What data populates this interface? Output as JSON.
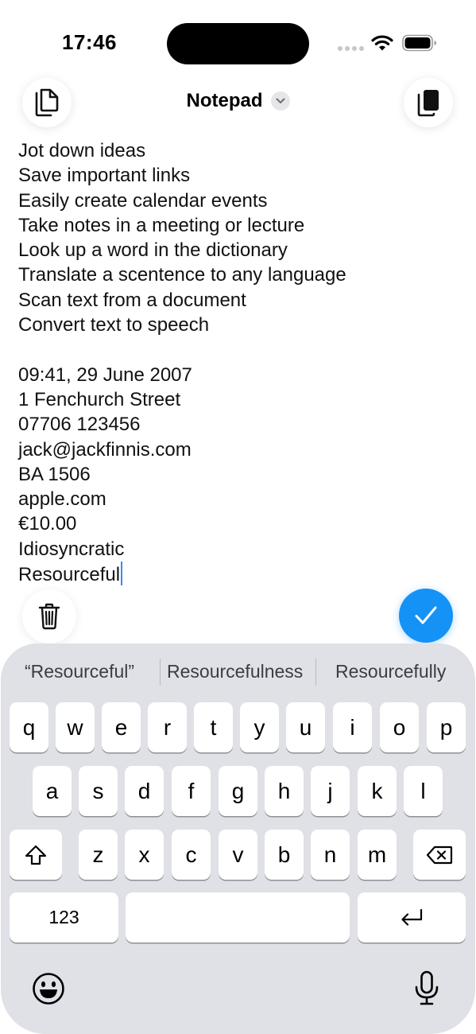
{
  "status_bar": {
    "time": "17:46",
    "icons": [
      "signal-dots-icon",
      "wifi-icon",
      "battery-icon"
    ]
  },
  "header": {
    "title": "Notepad",
    "left_icon": "copy-documents-icon",
    "right_icon": "paste-clipboard-icon",
    "title_icon": "chevron-down-icon"
  },
  "note": {
    "lines": [
      "Jot down ideas",
      "Save important links",
      "Easily create calendar events",
      "Take notes in a meeting or lecture",
      "Look up a word in the dictionary",
      "Translate a scentence to any language",
      "Scan text from a document",
      "Convert text to speech",
      "",
      "09:41, 29 June 2007",
      "1 Fenchurch Street",
      "07706 123456",
      "jack@jackfinnis.com",
      "BA 1506",
      "apple.com",
      "€10.00",
      "Idiosyncratic",
      "Resourceful"
    ]
  },
  "actions": {
    "trash_icon": "trash-icon",
    "done_icon": "checkmark-icon",
    "accent_color": "#1492f5"
  },
  "keyboard": {
    "suggestions": [
      "“Resourceful”",
      "Resourcefulness",
      "Resourcefully"
    ],
    "row1": [
      "q",
      "w",
      "e",
      "r",
      "t",
      "y",
      "u",
      "i",
      "o",
      "p"
    ],
    "row2": [
      "a",
      "s",
      "d",
      "f",
      "g",
      "h",
      "j",
      "k",
      "l"
    ],
    "row3": [
      "z",
      "x",
      "c",
      "v",
      "b",
      "n",
      "m"
    ],
    "numbers_label": "123",
    "shift_icon": "shift-icon",
    "delete_icon": "delete-backspace-icon",
    "return_icon": "return-icon",
    "emoji_icon": "emoji-icon",
    "mic_icon": "microphone-icon"
  }
}
